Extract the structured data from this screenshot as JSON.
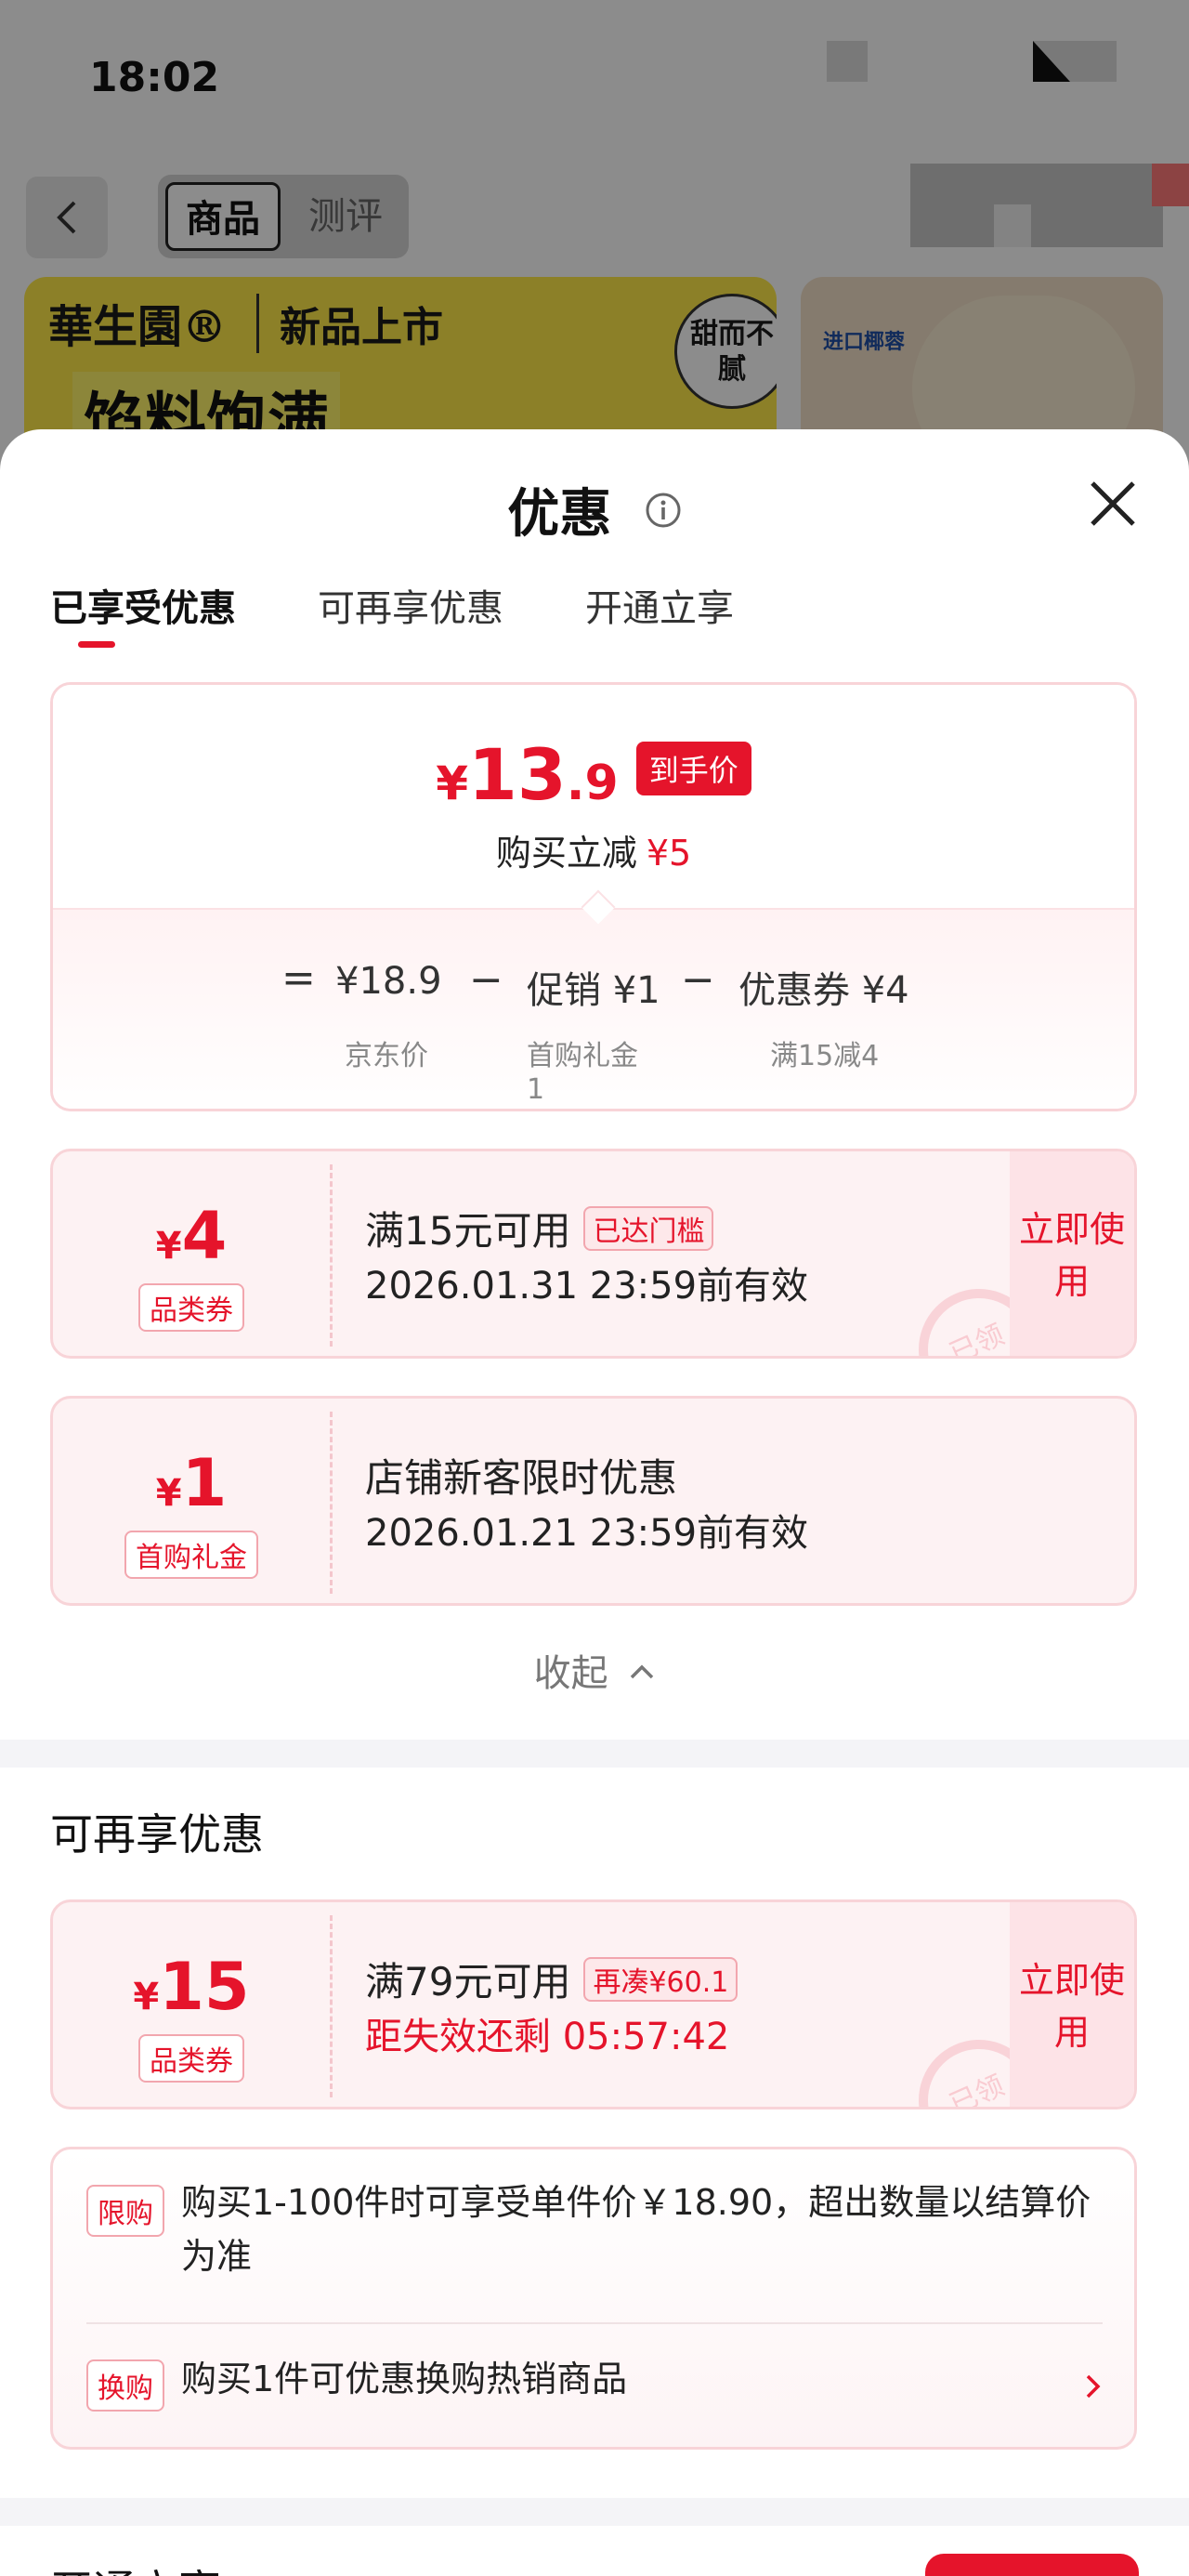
{
  "status_bar": {
    "time": "18:02"
  },
  "background_page": {
    "segment_tabs": [
      "商品",
      "测评"
    ],
    "banner_brand": "華生園®",
    "banner_new": "新品上市",
    "banner_big": "馅料饱满",
    "banner_badge": "甜而不腻",
    "card2_label": "进口椰蓉"
  },
  "sheet": {
    "title": "优惠",
    "tabs": [
      "已享受优惠",
      "可再享优惠",
      "开通立享"
    ]
  },
  "price_card": {
    "yen": "¥",
    "price_int": "13",
    "price_dec": ".9",
    "tag": "到手价",
    "cut_label": "购买立减",
    "cut_amount": "¥5",
    "eq": "=",
    "minus": "−",
    "items": [
      {
        "value": "¥18.9",
        "sub": "京东价"
      },
      {
        "value": "促销 ¥1",
        "sub": "首购礼金",
        "sub2": "1"
      },
      {
        "value": "优惠券 ¥4",
        "sub": "满15减4"
      }
    ]
  },
  "enjoyed_coupons": [
    {
      "yen": "¥",
      "amount": "4",
      "type": "品类券",
      "title": "满15元可用",
      "badge": "已达门槛",
      "valid": "2026.01.31 23:59前有效",
      "action": "立即使用",
      "stamp": "已领"
    },
    {
      "yen": "¥",
      "amount": "1",
      "type": "首购礼金",
      "title": "店铺新客限时优惠",
      "valid": "2026.01.21 23:59前有效"
    }
  ],
  "collapse_label": "收起",
  "more_section": {
    "title": "可再享优惠",
    "coupon": {
      "yen": "¥",
      "amount": "15",
      "type": "品类券",
      "title": "满79元可用",
      "badge": "再凑¥60.1",
      "valid": "距失效还剩 05:57:42",
      "action": "立即使用",
      "stamp": "已领"
    },
    "rules": [
      {
        "tag": "限购",
        "text": "购买1-100件时可享受单件价￥18.90，超出数量以结算价为准"
      },
      {
        "tag": "换购",
        "text": "购买1件可优惠换购热销商品"
      }
    ]
  },
  "open_section": {
    "title": "开通立享"
  },
  "colors": {
    "accent": "#e5142b",
    "coupon_bg": "#fdf2f3",
    "border": "#f8d4d8"
  },
  "icons": [
    "back-icon",
    "info-icon",
    "close-icon",
    "chevron-up-icon",
    "chevron-right-icon"
  ]
}
